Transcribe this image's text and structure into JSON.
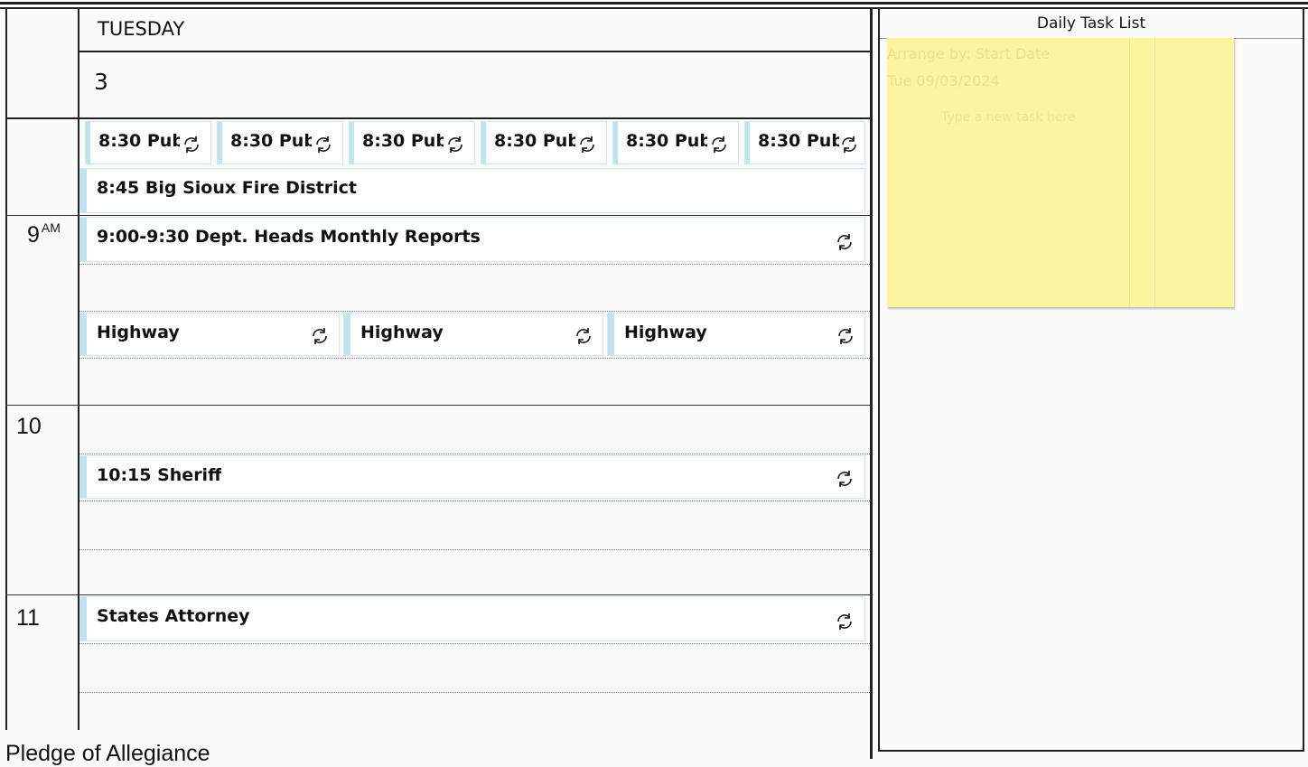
{
  "day": {
    "name": "TUESDAY",
    "date": "3"
  },
  "time_labels": [
    {
      "hour": "9",
      "suffix": "AM"
    },
    {
      "hour": "10",
      "suffix": ""
    },
    {
      "hour": "11",
      "suffix": ""
    }
  ],
  "appointments": {
    "pub_row": [
      "8:30 Pub",
      "8:30 Pub",
      "8:30 Pub",
      "8:30 Pub",
      "8:30 Pub",
      "8:30 Pub"
    ],
    "fire": "8:45 Big Sioux Fire District",
    "dept": "9:00-9:30 Dept. Heads Monthly Reports",
    "highway": [
      "Highway",
      "Highway",
      "Highway"
    ],
    "sheriff": "10:15 Sheriff",
    "states": "States Attorney"
  },
  "task_panel": {
    "title": "Daily Task List",
    "note_lines": [
      "Arrange by: Start Date",
      "Tue 09/03/2024",
      "Type a new task here"
    ]
  },
  "footer_text": "Pledge of Allegiance",
  "colors": {
    "appointment_bar": "#bfe3ef",
    "sticky_note": "#fbf5a0"
  },
  "icons": {
    "recurrence": "recurrence-icon"
  }
}
